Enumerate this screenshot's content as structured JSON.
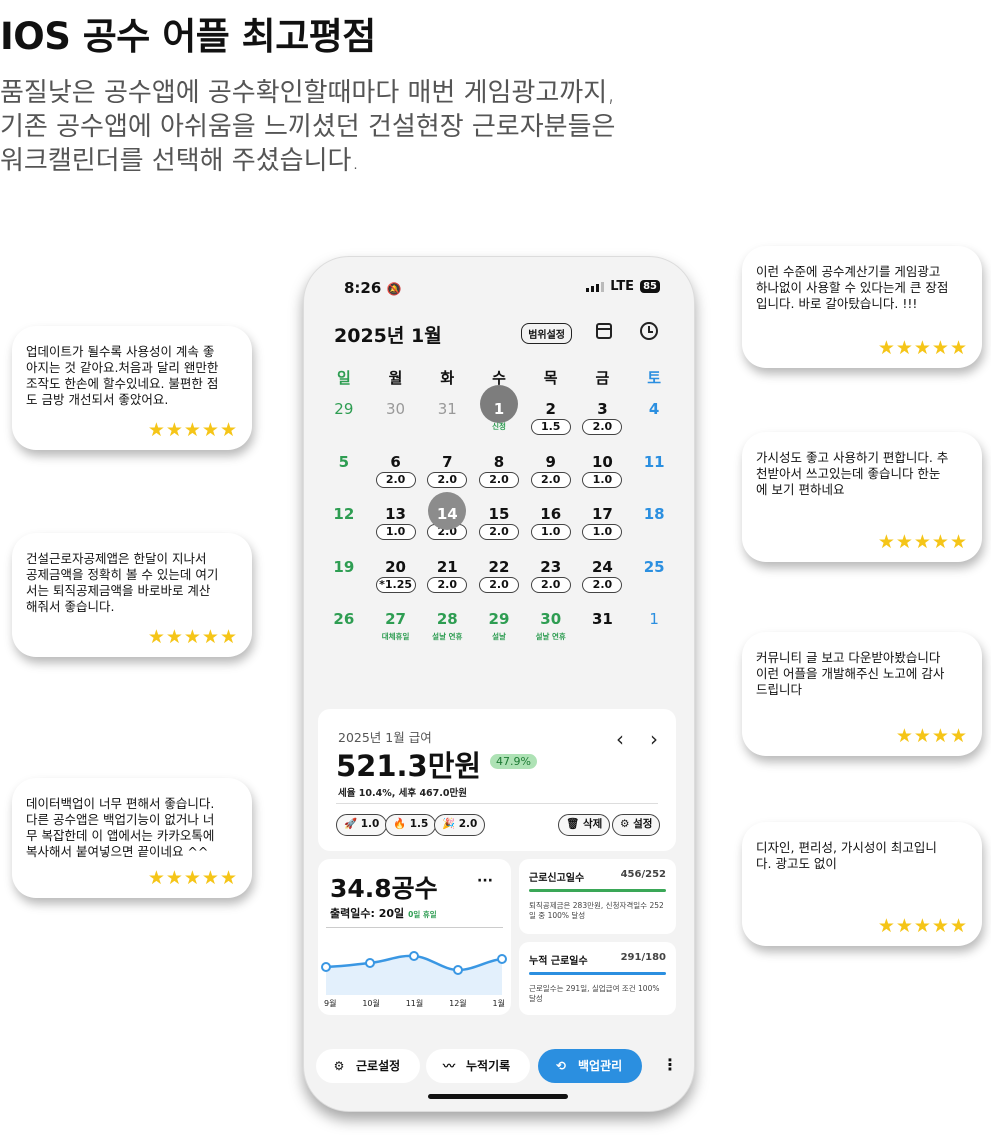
{
  "headline": "IOS 공수 어플 최고평점",
  "subtext": [
    "품질낮은 공수앱에 공수확인할때마다 매번 게임광고까지,",
    "기존 공수앱에 아쉬움을 느끼셨던 건설현장 근로자분들은",
    "워크캘린더를 선택해 주셨습니다."
  ],
  "reviews": [
    {
      "text": "업데이트가 될수록 사용성이 계속 좋\n아지는 것 같아요.처음과 달리 왠만한\n조작도 한손에 할수있네요. 불편한 점\n도 금방 개선되서 좋았어요.",
      "stars": "★★★★★"
    },
    {
      "text": "건설근로자공제앱은 한달이 지나서\n공제금액을 정확히 볼 수 있는데 여기\n서는 퇴직공제금액을 바로바로 계산\n해줘서 좋습니다.",
      "stars": "★★★★★"
    },
    {
      "text": "데이터백업이 너무 편해서 좋습니다.\n다른 공수앱은 백업기능이 없거나 너\n무 복잡한데 이 앱에서는 카카오톡에\n복사해서 붙여넣으면 끝이네요 ^^",
      "stars": "★★★★★"
    },
    {
      "text": "이런 수준에 공수계산기를 게임광고\n하나없이 사용할 수 있다는게 큰 장점\n입니다.  바로 갈아탔습니다. !!!",
      "stars": "★★★★★"
    },
    {
      "text": "가시성도 좋고 사용하기 편합니다. 추\n천받아서 쓰고있는데 좋습니다 한눈\n에 보기 편하네요",
      "stars": "★★★★★"
    },
    {
      "text": "커뮤니티 글 보고 다운받아봤습니다\n이런 어플을 개발해주신 노고에 감사\n드립니다",
      "stars": "★★★★"
    },
    {
      "text": "디자인, 편리성, 가시성이 최고입니\n다. 광고도 없이",
      "stars": "★★★★★"
    }
  ],
  "status": {
    "time": "8:26",
    "network": "LTE",
    "battery": "85"
  },
  "calendar": {
    "title": "2025년 1월",
    "range_button": "범위설정",
    "weekdays": [
      "일",
      "월",
      "화",
      "수",
      "목",
      "금",
      "토"
    ],
    "days": [
      {
        "n": "29",
        "muted": true
      },
      {
        "n": "30",
        "muted": true
      },
      {
        "n": "31",
        "muted": true
      },
      {
        "n": "1",
        "note": "신정",
        "circle": true
      },
      {
        "n": "2",
        "pill": "1.5"
      },
      {
        "n": "3",
        "pill": "2.0"
      },
      {
        "n": "4"
      },
      {
        "n": "5"
      },
      {
        "n": "6",
        "pill": "2.0"
      },
      {
        "n": "7",
        "pill": "2.0"
      },
      {
        "n": "8",
        "pill": "2.0"
      },
      {
        "n": "9",
        "pill": "2.0"
      },
      {
        "n": "10",
        "pill": "1.0"
      },
      {
        "n": "11"
      },
      {
        "n": "12"
      },
      {
        "n": "13",
        "pill": "1.0"
      },
      {
        "n": "14",
        "pill": "2.0",
        "circle": true
      },
      {
        "n": "15",
        "pill": "2.0"
      },
      {
        "n": "16",
        "pill": "1.0"
      },
      {
        "n": "17",
        "pill": "1.0"
      },
      {
        "n": "18"
      },
      {
        "n": "19"
      },
      {
        "n": "20",
        "pill": "*1.25"
      },
      {
        "n": "21",
        "pill": "2.0"
      },
      {
        "n": "22",
        "pill": "2.0"
      },
      {
        "n": "23",
        "pill": "2.0"
      },
      {
        "n": "24",
        "pill": "2.0"
      },
      {
        "n": "25"
      },
      {
        "n": "26"
      },
      {
        "n": "27",
        "note": "대체휴일",
        "holiday": true
      },
      {
        "n": "28",
        "note": "설날 연휴",
        "holiday": true
      },
      {
        "n": "29",
        "note": "설날",
        "holiday": true
      },
      {
        "n": "30",
        "note": "설날 연휴",
        "holiday": true
      },
      {
        "n": "31"
      },
      {
        "n": "1",
        "muted": true
      }
    ]
  },
  "salary": {
    "label": "2025년 1월 급여",
    "amount": "521.3만원",
    "percent": "47.9%",
    "tax": "세율 10.4%, 세후 467.0만원",
    "chips": [
      "1.0",
      "1.5",
      "2.0"
    ],
    "delete": "삭제",
    "settings": "설정"
  },
  "gongsu": {
    "total": "34.8공수",
    "days_label": "출력일수: 20일",
    "rest": "0일 휴일",
    "months": [
      "9월",
      "10월",
      "11월",
      "12월",
      "1월"
    ]
  },
  "stats": [
    {
      "title": "근로신고일수",
      "value": "456/252",
      "color": "#3aa757",
      "desc": "퇴직공제금은 283만원, 신청자격일수 252일 중 100% 달성"
    },
    {
      "title": "누적 근로일수",
      "value": "291/180",
      "color": "#2b8fe0",
      "desc": "근로일수는 291일, 실업급여 조건 100% 달성"
    }
  ],
  "bottom": {
    "settings": "근로설정",
    "records": "누적기록",
    "backup": "백업관리"
  },
  "colors": {
    "accent_blue": "#2b8fe0",
    "green": "#2e9d52",
    "star": "#f5c518"
  }
}
